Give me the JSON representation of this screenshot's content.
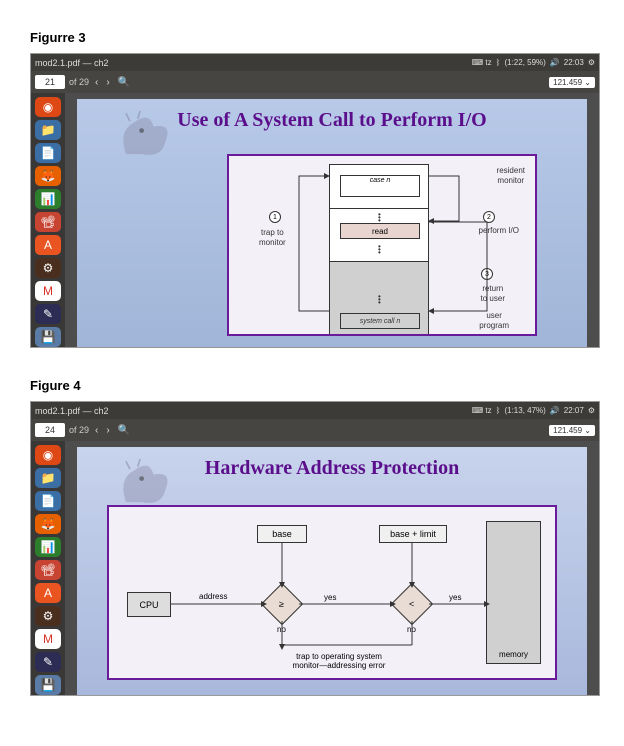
{
  "figure3": {
    "label": "Figurre 3"
  },
  "figure4": {
    "label": "Figure 4"
  },
  "window1": {
    "title": "mod2.1.pdf — ch2",
    "page_num": "21",
    "page_total": "of 29",
    "zoom": "121.459 ⌄",
    "time": "22:03",
    "battery": "(1:22, 59%)",
    "slide_title": "Use of A System Call to Perform I/O",
    "diagram": {
      "case_n": "case n",
      "read": "read",
      "syscall": "system call n",
      "resident_monitor": "resident\nmonitor",
      "trap": "trap to\nmonitor",
      "perform": "perform I/O",
      "return": "return\nto user",
      "userprog": "user\nprogram"
    }
  },
  "window2": {
    "title": "mod2.1.pdf — ch2",
    "page_num": "24",
    "page_total": "of 29",
    "zoom": "121.459 ⌄",
    "time": "22:07",
    "battery": "(1:13, 47%)",
    "slide_title": "Hardware Address Protection",
    "diagram": {
      "cpu": "CPU",
      "address": "address",
      "base": "base",
      "base_limit": "base + limit",
      "ge": "≥",
      "lt": "<",
      "yes": "yes",
      "no": "no",
      "trap": "trap to operating system\nmonitor—addressing error",
      "memory": "memory"
    }
  }
}
